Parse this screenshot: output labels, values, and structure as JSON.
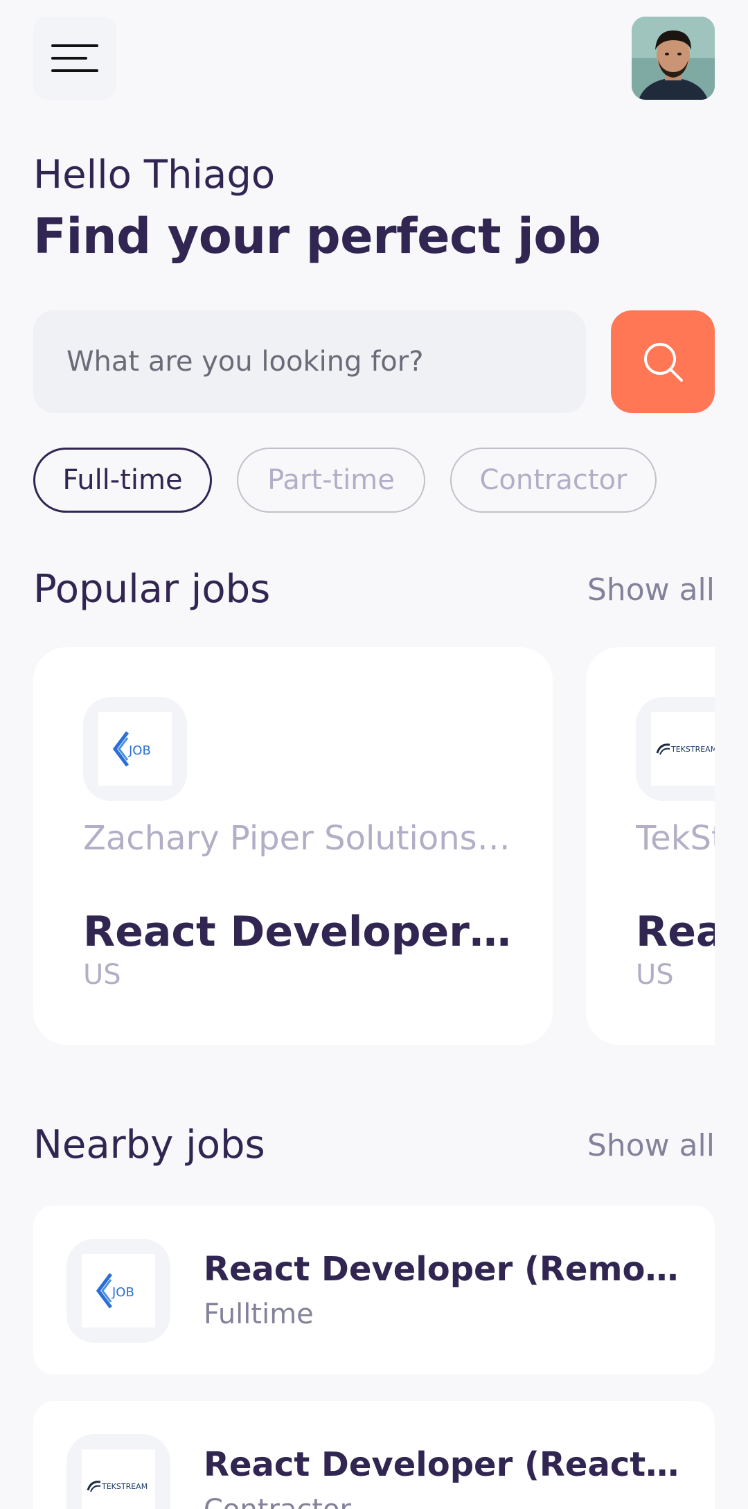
{
  "header": {
    "menu_icon": "menu-icon",
    "avatar_alt": "profile avatar"
  },
  "greeting": {
    "hello": "Hello Thiago",
    "headline": "Find your perfect job"
  },
  "search": {
    "placeholder": "What are you looking for?",
    "icon": "search-icon"
  },
  "job_types": [
    {
      "label": "Full-time",
      "active": true
    },
    {
      "label": "Part-time",
      "active": false
    },
    {
      "label": "Contractor",
      "active": false
    }
  ],
  "popular": {
    "title": "Popular jobs",
    "show_all": "Show all",
    "cards": [
      {
        "company": "Zachary Piper Solutions, L...",
        "title": "React Developer (Re...",
        "country": "US",
        "logo": "job-logo"
      },
      {
        "company": "TekSt",
        "title": "Reac",
        "country": "US",
        "logo": "tekstream-logo"
      }
    ]
  },
  "nearby": {
    "title": "Nearby jobs",
    "show_all": "Show all",
    "items": [
      {
        "title": "React Developer (Remote)",
        "type": "Fulltime",
        "logo": "job-logo"
      },
      {
        "title": "React Developer (Reactjs...",
        "type": "Contractor",
        "logo": "tekstream-logo"
      }
    ]
  },
  "colors": {
    "primary": "#312651",
    "accent": "#ff7754",
    "gray": "#83829a",
    "light_gray": "#b3aec6",
    "background": "#f8f8fb"
  }
}
